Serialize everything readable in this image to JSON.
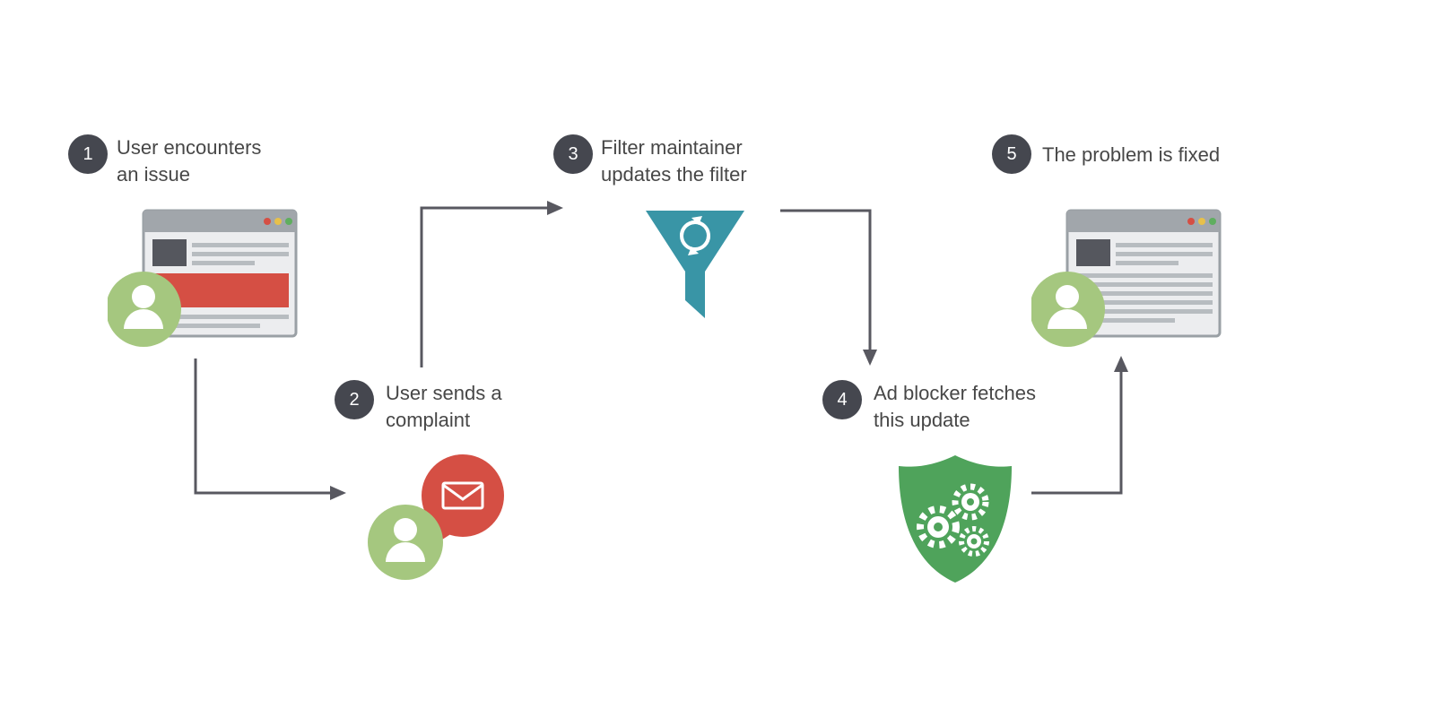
{
  "steps": [
    {
      "num": "1",
      "line1": "User encounters",
      "line2": "an issue"
    },
    {
      "num": "2",
      "line1": "User sends a",
      "line2": "complaint"
    },
    {
      "num": "3",
      "line1": "Filter maintainer",
      "line2": "updates the filter"
    },
    {
      "num": "4",
      "line1": "Ad blocker fetches",
      "line2": "this update"
    },
    {
      "num": "5",
      "line1": "The problem is fixed",
      "line2": ""
    }
  ],
  "colors": {
    "badge": "#45474f",
    "text": "#474747",
    "arrow": "#585860",
    "green": "#a5c77f",
    "shield": "#4fa35b",
    "red": "#d54f44",
    "teal": "#3995a6",
    "browserHeader": "#a1a6ab",
    "browserBody": "#ecedef",
    "line": "#b7bcc0"
  }
}
